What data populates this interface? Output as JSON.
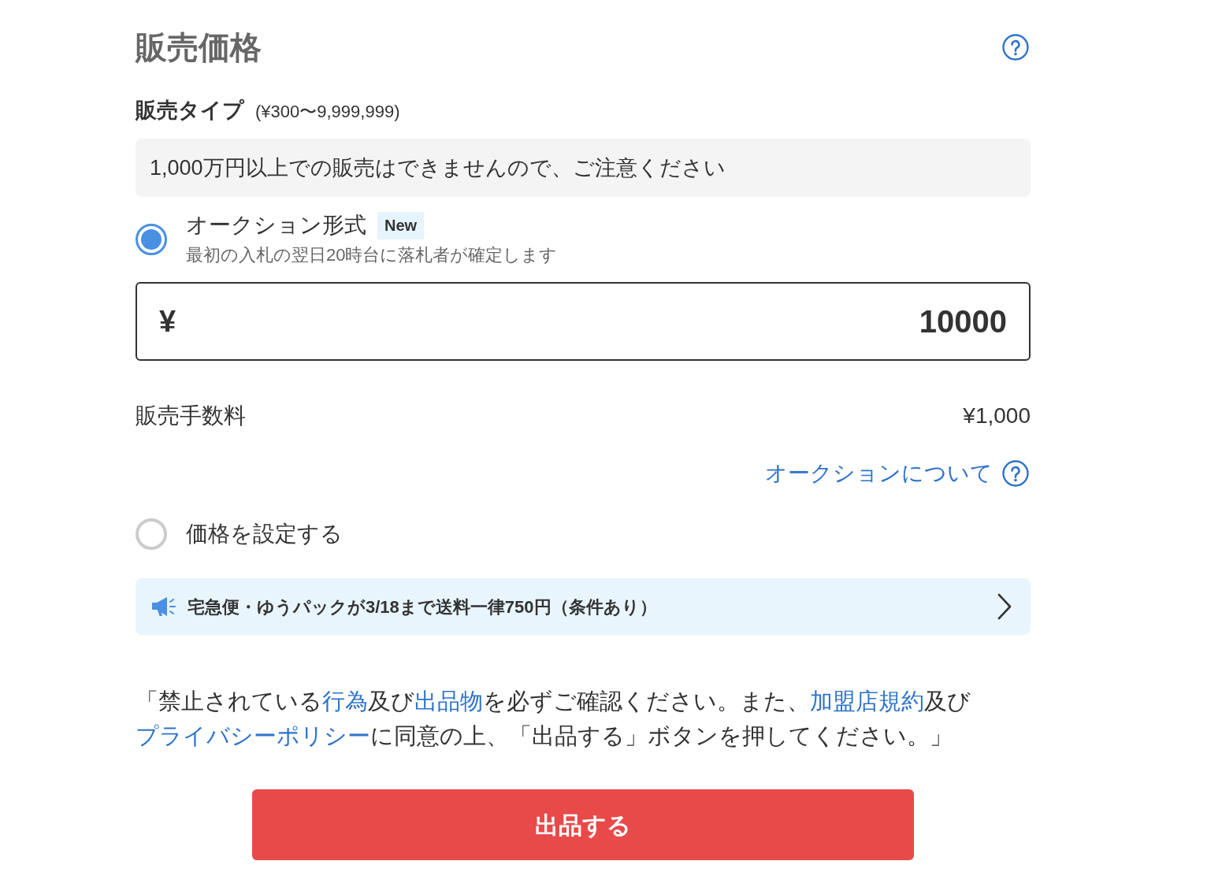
{
  "header": {
    "title": "販売価格"
  },
  "sale_type": {
    "label": "販売タイプ",
    "range": "(¥300〜9,999,999)"
  },
  "notice": "1,000万円以上での販売はできませんので、ご注意ください",
  "options": [
    {
      "label": "オークション形式",
      "badge": "New",
      "description": "最初の入札の翌日20時台に落札者が確定します",
      "selected": true,
      "details": {
        "price_field": {
          "currency": "¥",
          "value": "10000"
        },
        "fee": {
          "label": "販売手数料",
          "value": "¥1,000"
        },
        "help_link": "オークションについて"
      }
    },
    {
      "label": "価格を設定する",
      "selected": false
    }
  ],
  "promo_banner": {
    "text": "宅急便・ゆうパックが3/18まで送料一律750円（条件あり）"
  },
  "agreement": [
    {
      "kind": "text",
      "text": "「禁止されている"
    },
    {
      "kind": "link",
      "text": "行為"
    },
    {
      "kind": "text",
      "text": "及び"
    },
    {
      "kind": "link",
      "text": "出品物"
    },
    {
      "kind": "text",
      "text": "を必ずご確認ください。また、"
    },
    {
      "kind": "link",
      "text": "加盟店規約"
    },
    {
      "kind": "text",
      "text": "及び"
    },
    {
      "kind": "link",
      "text": "プライバシーポリシー"
    },
    {
      "kind": "text",
      "text": "に同意の上、「出品する」ボタンを押してください。」"
    }
  ],
  "submit_button": "出品する"
}
